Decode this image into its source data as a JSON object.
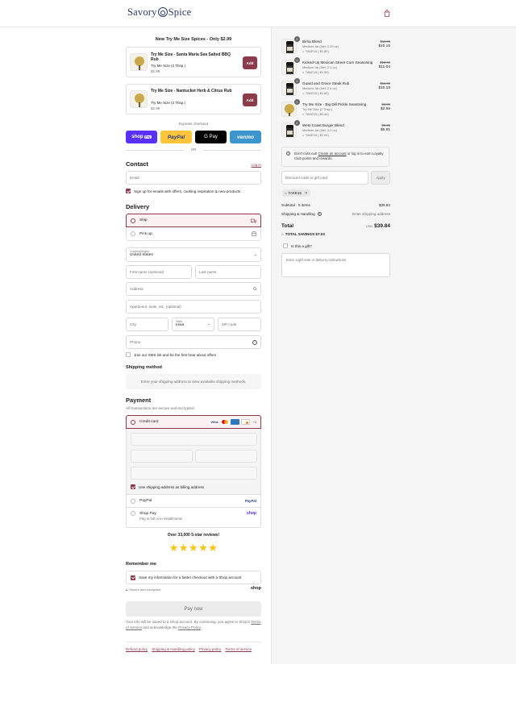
{
  "brand": {
    "name_left": "Savory",
    "name_right": "Spice"
  },
  "colors": {
    "accent": "#8d3b4b",
    "shop_pay": "#5a31f4",
    "paypal": "#ffc439",
    "venmo": "#3d95ce",
    "star": "#f5c518"
  },
  "upsell": {
    "title": "New Try Me Size Spices - Only $2.99",
    "items": [
      {
        "name": "Try Me Size - Santa Maria Sea Salted BBQ Rub",
        "variant": "Try Me Size (2 Tbsp.)",
        "price": "$2.99",
        "add": "Add"
      },
      {
        "name": "Try Me Size - Nantucket Herb & Citrus Rub",
        "variant": "Try Me Size (2 Tbsp.)",
        "price": "$2.99",
        "add": "Add"
      }
    ]
  },
  "express": {
    "label": "Express checkout",
    "or": "OR",
    "buttons": [
      "shop",
      "PayPal",
      "G Pay",
      "venmo"
    ],
    "shop_suffix": "Pay"
  },
  "contact": {
    "title": "Contact",
    "login": "Log in",
    "email_placeholder": "Email",
    "signup": "Sign up for emails with offers, cooking inspiration & new products"
  },
  "delivery": {
    "title": "Delivery",
    "ship": "Ship",
    "pickup": "Pick up",
    "country_label": "Country/Region",
    "country": "United States",
    "first_name": "First name (optional)",
    "last_name": "Last name",
    "address": "Address",
    "apartment": "Apartment, suite, etc. (optional)",
    "city": "City",
    "state_label": "State",
    "state": "Iowa",
    "zip": "ZIP code",
    "phone": "Phone",
    "sms": "Join our SMS list and be the first hear about offers"
  },
  "shipping_method": {
    "title": "Shipping method",
    "note": "Enter your shipping address to view available shipping methods."
  },
  "payment": {
    "title": "Payment",
    "subtitle": "All transactions are secure and encrypted.",
    "credit_card": "Credit card",
    "card_more": "+4",
    "billing_same": "Use shipping address as billing address",
    "paypal": "PayPal",
    "paypal_logo": "PayPal",
    "shop_pay": "Shop Pay",
    "shop_pay_sub": "Pay in full or in installments",
    "shop_logo": "shop"
  },
  "reviews": {
    "title": "Over 33,000 5-star reviews!",
    "stars": 5
  },
  "remember": {
    "title": "Remember me",
    "save": "Save my information for a faster checkout with a Shop account",
    "secure": "Secure and encrypted",
    "shop_logo": "shop"
  },
  "pay_now": "Pay now",
  "legal": {
    "text1": "Your info will be saved to a Shop account. By continuing, you agree to Shop's",
    "terms": "Terms of Service",
    "text2": "and acknowledge the",
    "privacy": "Privacy Policy",
    "end": "."
  },
  "footer_links": [
    "Refund policy",
    "Shipping & Handling policy",
    "Privacy policy",
    "Terms of service"
  ],
  "cart": {
    "items": [
      {
        "qty": "1",
        "name": "Birria Blend",
        "variant": "Medium Jar (Net: 2.25 oz)",
        "discount": "TAKE15 (-$1.80)",
        "old": "$11.95",
        "price": "$10.15",
        "kind": "jar"
      },
      {
        "qty": "1",
        "name": "Kicked-Up Mexican Street Corn Seasoning",
        "variant": "Medium Jar (Net: 2.4 oz)",
        "discount": "TAKE15 (-$1.95)",
        "old": "$12.99",
        "price": "$11.04",
        "kind": "jar"
      },
      {
        "qty": "1",
        "name": "Guard and Grace Steak Rub",
        "variant": "Medium Jar (Net: 2.4 oz)",
        "discount": "TAKE15 (-$1.80)",
        "old": "$11.99",
        "price": "$10.19",
        "kind": "jar"
      },
      {
        "qty": "1",
        "name": "Try Me Size - Big Dill Pickle Seasoning",
        "variant": "Try Me Size (2 Tbsp.)",
        "discount": "TAKE15 (-$0.44)",
        "old": "$2.99",
        "price": "$2.55",
        "kind": "puck"
      },
      {
        "qty": "1",
        "name": "West Coast Burger Blend",
        "variant": "Medium Jar (Net: 3.2 oz)",
        "discount": "TAKE15 (-$1.04)",
        "old": "$6.95",
        "price": "$5.81",
        "kind": "jar"
      }
    ],
    "loyalty": {
      "pre": "Don't miss out!",
      "link": "Create an account",
      "post": "or log in to earn Loyalty Club points and rewards."
    },
    "discount_placeholder": "Discount code or gift card",
    "apply": "Apply",
    "code": "TAKE15",
    "subtotal_label": "Subtotal · 5 items",
    "subtotal": "$39.84",
    "shipping_label": "Shipping & Handling",
    "shipping_value": "Enter shipping address",
    "total_label": "Total",
    "currency": "USD",
    "total": "$39.84",
    "savings": "TOTAL SAVINGS  $7.03",
    "gift_q": "Is this a gift?",
    "gift_placeholder": "Enter a gift note or delivery instructions"
  }
}
